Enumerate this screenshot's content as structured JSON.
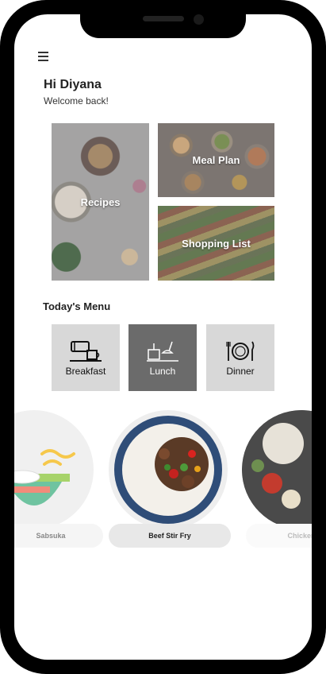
{
  "user": {
    "greeting": "Hi Diyana",
    "welcome": "Welcome back!"
  },
  "tiles": {
    "recipes": "Recipes",
    "meal_plan": "Meal Plan",
    "shopping_list": "Shopping List"
  },
  "menu_section": {
    "title": "Today's Menu"
  },
  "categories": [
    {
      "label": "Breakfast",
      "icon": "breakfast-icon",
      "active": false
    },
    {
      "label": "Lunch",
      "icon": "lunch-icon",
      "active": true
    },
    {
      "label": "Dinner",
      "icon": "dinner-icon",
      "active": false
    }
  ],
  "dishes": [
    {
      "name": "Sabsuka",
      "selected": false
    },
    {
      "name": "Beef Stir Fry",
      "selected": true
    },
    {
      "name": "Chicken",
      "selected": false
    }
  ],
  "colors": {
    "active_card": "#6b6b6b",
    "inactive_card": "#d8d8d8",
    "frame": "#000000"
  }
}
